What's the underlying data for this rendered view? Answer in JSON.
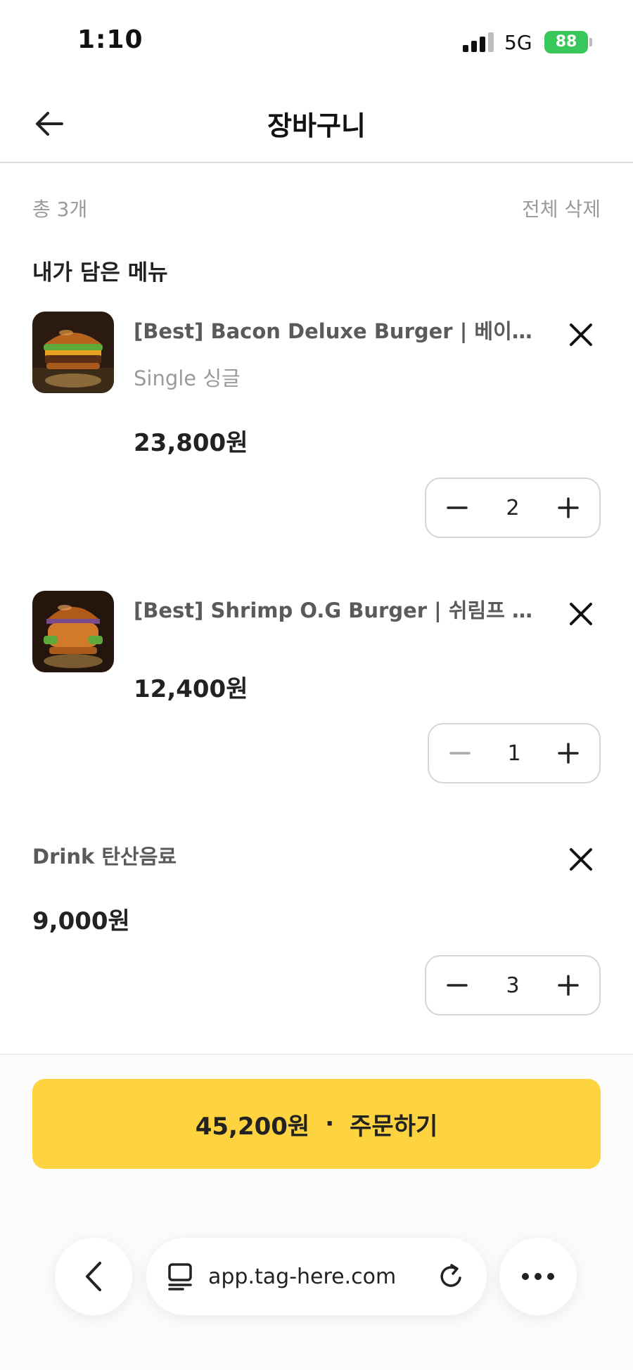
{
  "status_bar": {
    "time": "1:10",
    "network": "5G",
    "battery": "88"
  },
  "header": {
    "title": "장바구니"
  },
  "summary": {
    "count_label": "총 3개",
    "delete_all_label": "전체 삭제"
  },
  "section_title": "내가 담은 메뉴",
  "items": [
    {
      "name": "[Best] Bacon Deluxe Burger | 베이컨 디럭스 버거",
      "option": "Single 싱글",
      "price": "23,800원",
      "quantity": "2",
      "image": "bacon-burger"
    },
    {
      "name": "[Best] Shrimp O.G Burger | 쉬림프 O.G 버거",
      "price": "12,400원",
      "quantity": "1",
      "image": "shrimp-burger"
    },
    {
      "name": "Drink 탄산음료",
      "price": "9,000원",
      "quantity": "3"
    }
  ],
  "order_button": {
    "total": "45,200원",
    "separator": "·",
    "label": "주문하기"
  },
  "browser": {
    "url": "app.tag-here.com"
  },
  "colors": {
    "accent": "#fdd340",
    "battery": "#37c75a",
    "muted_text": "#9a9a9a"
  },
  "icons": {
    "back": "arrow-left-icon",
    "remove": "close-icon",
    "decrease": "minus-icon",
    "increase": "plus-icon",
    "browser_back": "chevron-left-icon",
    "reader": "reader-icon",
    "reload": "reload-icon",
    "more": "more-icon"
  }
}
